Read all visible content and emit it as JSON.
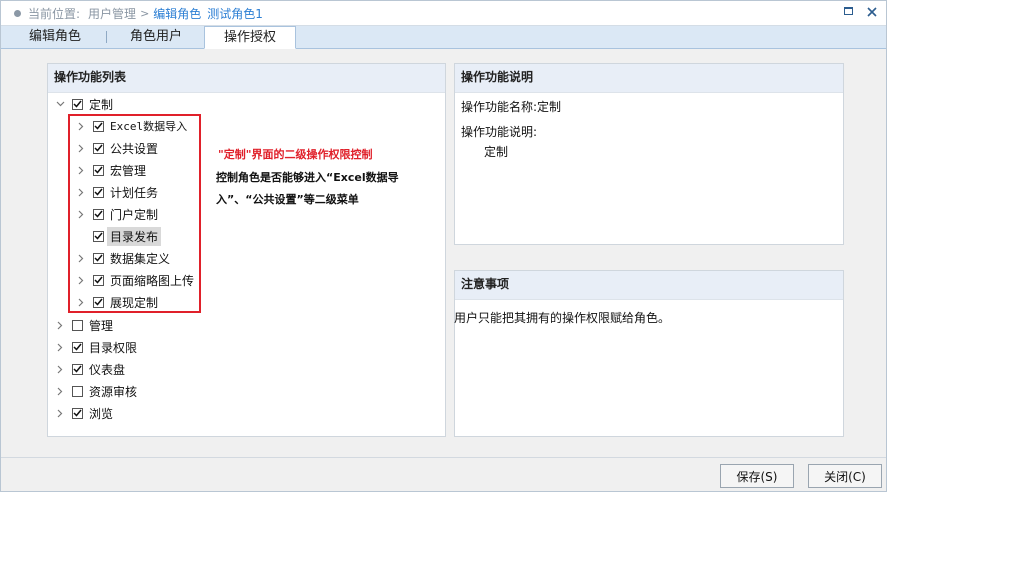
{
  "breadcrumb": {
    "label": "当前位置:",
    "items": [
      "用户管理",
      "编辑角色",
      "测试角色1"
    ]
  },
  "window_controls": {
    "maximize": "maximize",
    "close": "close"
  },
  "tabs": [
    {
      "label": "编辑角色",
      "active": false
    },
    {
      "label": "角色用户",
      "active": false
    },
    {
      "label": "操作授权",
      "active": true
    }
  ],
  "function_list": {
    "title": "操作功能列表",
    "tree": [
      {
        "label": "定制",
        "checked": true,
        "expanded": true,
        "children": [
          {
            "label": "Excel数据导入",
            "checked": true,
            "has_children": true
          },
          {
            "label": "公共设置",
            "checked": true,
            "has_children": true
          },
          {
            "label": "宏管理",
            "checked": true,
            "has_children": true
          },
          {
            "label": "计划任务",
            "checked": true,
            "has_children": true
          },
          {
            "label": "门户定制",
            "checked": true,
            "has_children": true
          },
          {
            "label": "目录发布",
            "checked": true,
            "has_children": false,
            "selected": true
          },
          {
            "label": "数据集定义",
            "checked": true,
            "has_children": true
          },
          {
            "label": "页面缩略图上传",
            "checked": true,
            "has_children": true
          },
          {
            "label": "展现定制",
            "checked": true,
            "has_children": true
          }
        ]
      },
      {
        "label": "管理",
        "checked": false,
        "expanded": false
      },
      {
        "label": "目录权限",
        "checked": true,
        "expanded": false
      },
      {
        "label": "仪表盘",
        "checked": true,
        "expanded": false
      },
      {
        "label": "资源审核",
        "checked": false,
        "expanded": false
      },
      {
        "label": "浏览",
        "checked": true,
        "expanded": false
      }
    ]
  },
  "annotation": {
    "red_text": "\"定制\"界面的二级操作权限控制",
    "black_text": "控制角色是否能够进入“Excel数据导入”、“公共设置”等二级菜单"
  },
  "function_desc": {
    "title": "操作功能说明",
    "name_label": "操作功能名称:",
    "name_value": "定制",
    "desc_label": "操作功能说明:",
    "desc_value": "定制"
  },
  "notes": {
    "title": "注意事项",
    "text": "用户只能把其拥有的操作权限赋给角色。"
  },
  "buttons": {
    "save": "保存(S)",
    "close": "关闭(C)"
  },
  "colors": {
    "accent_blue": "#2c7fd4",
    "tab_bar": "#dbe8f5",
    "panel_header": "#e8eef7",
    "highlight_red": "#e0202a"
  }
}
